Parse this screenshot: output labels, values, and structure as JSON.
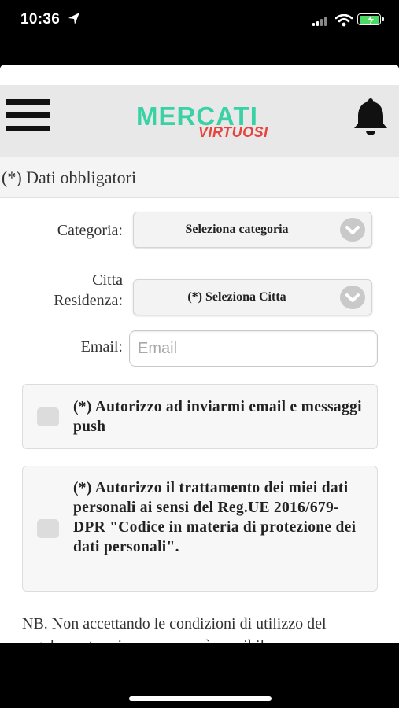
{
  "status_bar": {
    "time": "10:36"
  },
  "header": {
    "logo_main": "MERCATI",
    "logo_sub": "VIRTUOSI"
  },
  "required_note": "(*) Dati obbligatori",
  "form": {
    "categoria": {
      "label": "Categoria:",
      "value": "Seleziona categoria"
    },
    "citta": {
      "label_line1": "Citta",
      "label_line2": "Residenza:",
      "value": "(*) Seleziona Citta"
    },
    "email": {
      "label": "Email:",
      "placeholder": "Email",
      "value": ""
    }
  },
  "consents": [
    {
      "text": "(*) Autorizzo ad inviarmi email e messaggi push",
      "checked": false
    },
    {
      "text": "(*) Autorizzo il trattamento dei miei dati personali ai sensi del Reg.UE 2016/679-DPR \"Codice in materia di protezione dei dati personali\".",
      "checked": false
    }
  ],
  "note": "NB. Non accettando le condizioni di utilizzo del regolamento privacy, non sarà possibile",
  "colors": {
    "logo_main": "#3ad2a5",
    "logo_sub": "#e8443f",
    "header_bg": "#e8e8e8",
    "battery": "#4cd964"
  },
  "icons": [
    "location-arrow-icon",
    "signal-icon",
    "wifi-icon",
    "battery-charging-icon",
    "hamburger-menu-icon",
    "bell-icon",
    "chevron-down-icon"
  ]
}
